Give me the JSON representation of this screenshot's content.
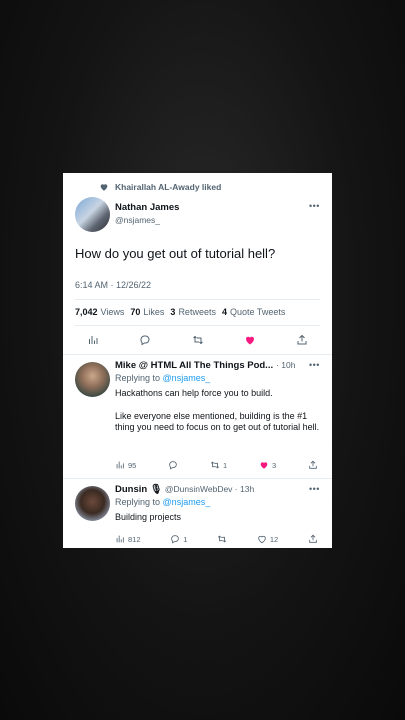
{
  "liked_by": "Khairallah AL-Awady liked",
  "tweet": {
    "name": "Nathan James",
    "handle": "@nsjames_",
    "text": "How do you get out of tutorial hell?",
    "timestamp": "6:14 AM · 12/26/22",
    "stats": {
      "views_num": "7,042",
      "views_label": "Views",
      "likes_num": "70",
      "likes_label": "Likes",
      "retweets_num": "3",
      "retweets_label": "Retweets",
      "quotes_num": "4",
      "quotes_label": "Quote Tweets"
    }
  },
  "replies": [
    {
      "name": "Mike @ HTML All The Things Pod...",
      "time": "· 10h",
      "replying_prefix": "Replying to",
      "replying_handle": "@nsjames_",
      "line1": "Hackathons can help force you to build.",
      "line2": "Like everyone else mentioned, building is the #1 thing you need to focus on to get out of tutorial hell.",
      "views": "95",
      "retweets": "1",
      "likes": "3"
    },
    {
      "name": "Dunsin 🎙",
      "handle_time": "@DunsinWebDev · 13h",
      "replying_prefix": "Replying to",
      "replying_handle": "@nsjames_",
      "line1": "Building projects",
      "views": "812",
      "comments": "1",
      "likes": "12"
    }
  ],
  "colors": {
    "like_pink": "#f91880",
    "link_blue": "#1d9bf0",
    "muted": "#536471"
  }
}
